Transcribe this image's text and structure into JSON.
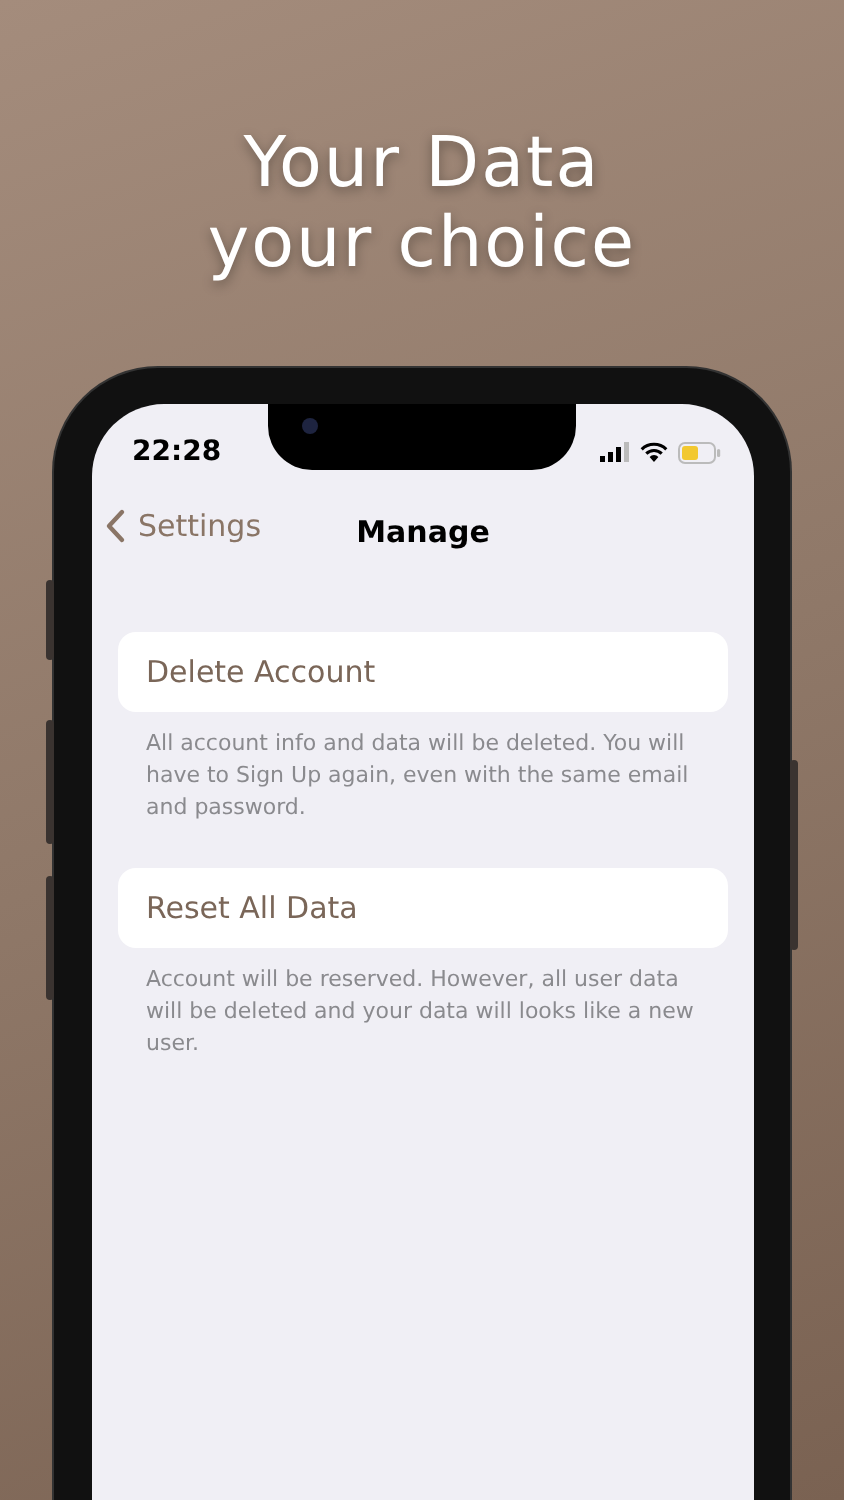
{
  "headline": [
    "Your Data",
    "your choice"
  ],
  "status_bar": {
    "time": "22:28"
  },
  "nav": {
    "back_label": "Settings",
    "title": "Manage"
  },
  "sections": [
    {
      "label": "Delete Account",
      "footer": "All account info and data will be deleted. You will have to Sign Up again, even with the same email and password."
    },
    {
      "label": "Reset All Data",
      "footer": "Account will be reserved. However, all user data will be deleted and your data will looks like a new user."
    }
  ]
}
